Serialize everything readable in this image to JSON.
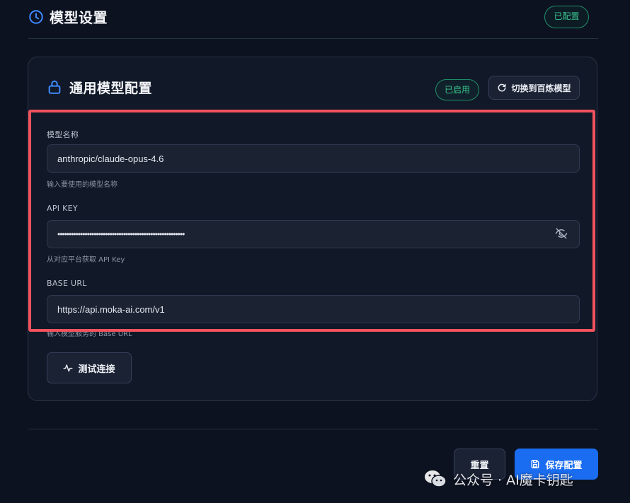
{
  "header": {
    "title": "模型设置",
    "status_badge": "已配置"
  },
  "card": {
    "title": "通用模型配置",
    "enabled_badge": "已启用",
    "switch_button_label": "切换到百炼模型",
    "fields": {
      "model_name": {
        "label": "模型名称",
        "value": "anthropic/claude-opus-4.6",
        "hint": "输入要使用的模型名称"
      },
      "api_key": {
        "label": "API KEY",
        "value": "••••••••••••••••••••••••••••••••••••••••••••••••••••••••",
        "hint": "从对应平台获取 API Key"
      },
      "base_url": {
        "label": "BASE URL",
        "value": "https://api.moka-ai.com/v1",
        "hint": "输入模型服务的 Base URL"
      }
    },
    "test_button_label": "测试连接"
  },
  "footer": {
    "reset_label": "重置",
    "save_label": "保存配置"
  },
  "watermark": {
    "text": "公众号 · AI魔卡钥匙"
  },
  "icons": {
    "title": "clock-icon",
    "card": "lock-icon",
    "switch": "refresh-icon",
    "password_toggle": "eye-off-icon",
    "test": "activity-icon",
    "save": "save-icon",
    "watermark": "wechat-icon"
  },
  "colors": {
    "background": "#0d1220",
    "card": "#111827",
    "accent_blue": "#1a6cf0",
    "status_green": "#39c58f",
    "highlight_red": "#f0525d"
  }
}
